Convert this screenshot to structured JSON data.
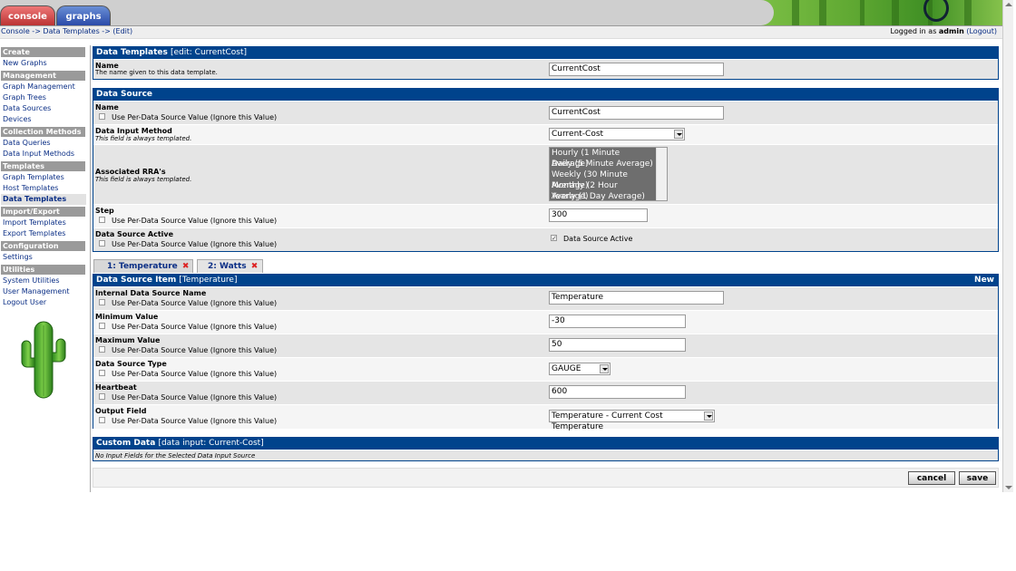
{
  "nav": {
    "console_tab": "console",
    "graphs_tab": "graphs"
  },
  "breadcrumb": {
    "text": "Console -> Data Templates -> (Edit)"
  },
  "login": {
    "prefix": "Logged in as ",
    "user": "admin",
    "logout": "(Logout)"
  },
  "sidebar": {
    "sections": [
      {
        "header": "Create",
        "items": [
          "New Graphs"
        ]
      },
      {
        "header": "Management",
        "items": [
          "Graph Management",
          "Graph Trees",
          "Data Sources",
          "Devices"
        ]
      },
      {
        "header": "Collection Methods",
        "items": [
          "Data Queries",
          "Data Input Methods"
        ]
      },
      {
        "header": "Templates",
        "items": [
          "Graph Templates",
          "Host Templates",
          "Data Templates"
        ]
      },
      {
        "header": "Import/Export",
        "items": [
          "Import Templates",
          "Export Templates"
        ]
      },
      {
        "header": "Configuration",
        "items": [
          "Settings"
        ]
      },
      {
        "header": "Utilities",
        "items": [
          "System Utilities",
          "User Management",
          "Logout User"
        ]
      }
    ],
    "active_item": "Data Templates"
  },
  "template_panel": {
    "title": "Data Templates",
    "subtitle": "[edit: CurrentCost]",
    "name_label": "Name",
    "name_desc": "The name given to this data template.",
    "name_value": "CurrentCost"
  },
  "source_panel": {
    "title": "Data Source",
    "per_ds_label": "Use Per-Data Source Value (Ignore this Value)",
    "name_label": "Name",
    "name_value": "CurrentCost",
    "input_method_label": "Data Input Method",
    "input_method_desc": "This field is always templated.",
    "input_method_value": "Current-Cost",
    "rra_label": "Associated RRA's",
    "rra_desc": "This field is always templated.",
    "rra_options": [
      "Hourly (1 Minute Average)",
      "Daily (5 Minute Average)",
      "Weekly (30 Minute Average)",
      "Monthly (2 Hour Average)",
      "Yearly (1 Day Average)"
    ],
    "step_label": "Step",
    "step_value": "300",
    "active_label": "Data Source Active",
    "active_checkbox_label": "Data Source Active"
  },
  "ds_tabs": [
    {
      "label": "1: Temperature"
    },
    {
      "label": "2: Watts"
    }
  ],
  "item_panel": {
    "title": "Data Source Item",
    "subtitle": "[Temperature]",
    "new_link": "New",
    "per_ds_label": "Use Per-Data Source Value (Ignore this Value)",
    "internal_name_label": "Internal Data Source Name",
    "internal_name_value": "Temperature",
    "min_label": "Minimum Value",
    "min_value": "-30",
    "max_label": "Maximum Value",
    "max_value": "50",
    "type_label": "Data Source Type",
    "type_value": "GAUGE",
    "heartbeat_label": "Heartbeat",
    "heartbeat_value": "600",
    "output_label": "Output Field",
    "output_value": "Temperature - Current Cost Temperature"
  },
  "custom_panel": {
    "title": "Custom Data",
    "subtitle": "[data input: Current-Cost]",
    "note": "No Input Fields for the Selected Data Input Source"
  },
  "buttons": {
    "cancel": "cancel",
    "save": "save"
  },
  "colors": {
    "panel_header": "#00438c",
    "link": "#0b2f86",
    "tab_x": "#dd2222"
  },
  "icons": [
    "cactus-logo-icon",
    "dropdown-arrow-icon",
    "remove-x-icon",
    "checkbox-icon"
  ]
}
